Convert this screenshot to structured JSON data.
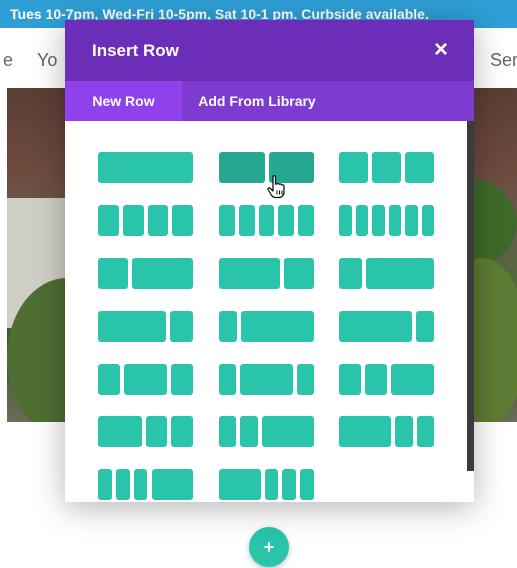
{
  "banner": {
    "text": "Tues 10-7pm, Wed-Fri 10-5pm, Sat 10-1 pm. Curbside available."
  },
  "nav": {
    "left_fragment": "e",
    "item1_fragment": "Yo",
    "item2_fragment": "Ser"
  },
  "modal": {
    "title": "Insert Row",
    "close_glyph": "×",
    "tabs": [
      {
        "label": "New Row",
        "active": true
      },
      {
        "label": "Add From Library",
        "active": false
      }
    ]
  },
  "row_layouts": [
    [
      1
    ],
    [
      1,
      1
    ],
    [
      1,
      1,
      1
    ],
    [
      1,
      1,
      1,
      1
    ],
    [
      1,
      1,
      1,
      1,
      1
    ],
    [
      1,
      1,
      1,
      1,
      1,
      1
    ],
    [
      1,
      2
    ],
    [
      2,
      1
    ],
    [
      1,
      3
    ],
    [
      3,
      1
    ],
    [
      1,
      4
    ],
    [
      4,
      1
    ],
    [
      1,
      2,
      1
    ],
    [
      1,
      3,
      1
    ],
    [
      1,
      1,
      2
    ],
    [
      2,
      1,
      1
    ],
    [
      1,
      1,
      3
    ],
    [
      3,
      1,
      1
    ],
    [
      1,
      1,
      1,
      3
    ],
    [
      3,
      1,
      1,
      1
    ]
  ],
  "hovered_layout_index": 1,
  "page_add_button": {
    "label": "+"
  },
  "colors": {
    "purple_header": "#6c2eb9",
    "purple_tabs": "#7e3bd0",
    "active_tab": "#8f42ec",
    "teal": "#29c4a9",
    "banner_blue": "#2e9fd6"
  }
}
